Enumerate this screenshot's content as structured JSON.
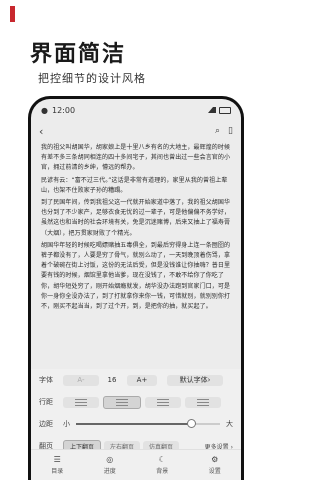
{
  "hero": {
    "title": "界面简洁",
    "subtitle": "把控细节的设计风格",
    "accent_color": "#c8282e"
  },
  "status": {
    "time": "12:00"
  },
  "toolbar": {
    "back_icon": "back-arrow-icon",
    "search_icon": "search-icon",
    "bookmark_icon": "bookmark-icon"
  },
  "reader": {
    "paragraphs": [
      "我的祖父叫胡国华，胡家娘上是十里八乡有名的大地主，最辉煌的时候有差不多三条胡同相连的四十多间宅子，其间也曾出过一些会言官的小官，拥过前清的乡绅，懵远的帮办。",
      "民谚有云：“富不过三代。”这话是非常有道理的，家里从我的曾祖上辈山，也架不住败家子孙的糟蹋。",
      "到了民国年间，传到我祖父这一代就开始家道中落了，我的祖父胡国华也分到了不少家产，足够衣食无忧的过一辈子，可是他偏偏不务学好，虽然这也和当时的社会环境有关，免是沉迷赌博，后来又抽上了福寿膏（大烟），把万贯家财败了个精光。",
      "胡国华年轻的时候吃喝嫖赌抽五毒俱全，到最后穷得身上连一条囫囵的裤子都没有了，人要是穷了骨气，就别么动了，一天到晚顶着伤骂，拿着个破碗在街上讨饭，这份的无法后受，但是没钱谁让你抽嗨？普日里要有钱的时候，烟馆里拿他当爹，现在没钱了，不敢不给你了你吃了你，胡华短处穷了，刚开始烟瘾就发，胡华没办法跑到官家门口，可是你一身你全没办法了，到了打就拿你来你一钱，可惜就别，就别别你打不，刚买不起当当，到了过个开，到，是把你的抽，就买起了。"
    ]
  },
  "settings": {
    "font_label": "字体",
    "font_decrease": "A-",
    "font_size": "16",
    "font_increase": "A+",
    "font_default": "默认字体",
    "spacing_label": "行距",
    "brightness_label": "边距",
    "brightness_min": "小",
    "brightness_max": "大",
    "brightness_level": 0.8,
    "page_label": "翻页",
    "page_modes": [
      "上下翻页",
      "左右翻页",
      "仿真翻页"
    ],
    "more_settings": "更多设置"
  },
  "tabs": [
    {
      "label": "目录",
      "icon": "menu-list-icon"
    },
    {
      "label": "进度",
      "icon": "progress-icon"
    },
    {
      "label": "背景",
      "icon": "moon-icon"
    },
    {
      "label": "设置",
      "icon": "settings-icon"
    }
  ]
}
